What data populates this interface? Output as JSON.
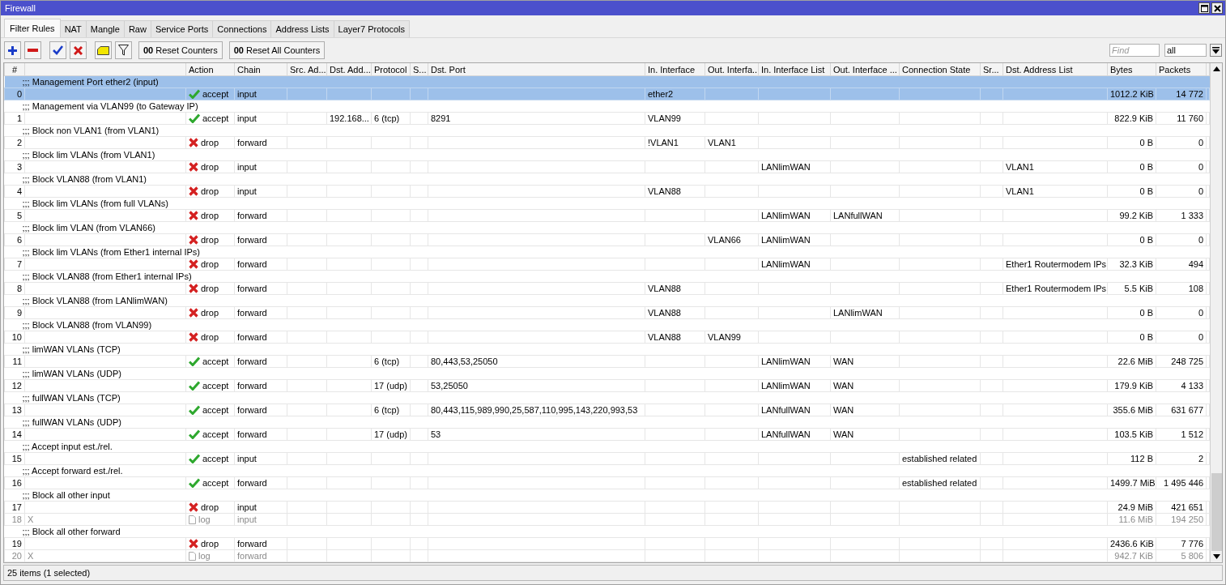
{
  "window": {
    "title": "Firewall"
  },
  "tabs": [
    {
      "label": "Filter Rules",
      "selected": true
    },
    {
      "label": "NAT",
      "selected": false
    },
    {
      "label": "Mangle",
      "selected": false
    },
    {
      "label": "Raw",
      "selected": false
    },
    {
      "label": "Service Ports",
      "selected": false
    },
    {
      "label": "Connections",
      "selected": false
    },
    {
      "label": "Address Lists",
      "selected": false
    },
    {
      "label": "Layer7 Protocols",
      "selected": false
    }
  ],
  "toolbar": {
    "buttons": [
      {
        "kind": "add"
      },
      {
        "kind": "remove"
      },
      {
        "kind": "enable"
      },
      {
        "kind": "disable"
      },
      {
        "kind": "comment"
      },
      {
        "kind": "filter"
      },
      {
        "kind": "text",
        "label": "**00** Reset Counters"
      },
      {
        "kind": "text",
        "label": "**00** Reset All Counters"
      }
    ],
    "find": {
      "placeholder": "Find"
    },
    "filter_select": {
      "value": "all"
    }
  },
  "table": {
    "columns": [
      "#",
      "Action",
      "Chain",
      "Src. Ad...",
      "Dst. Add...",
      "Protocol",
      "S...",
      "Dst. Port",
      "In. Interface",
      "Out. Interfa...",
      "In. Interface List",
      "Out. Interface ...",
      "Connection State",
      "Sr...",
      "Dst. Address List",
      "Bytes",
      "Packets"
    ],
    "rules": [
      {
        "comment": ";;; Management Port ether2 (input)",
        "selected": true,
        "disabled": false,
        "num": "0",
        "kind": "accept",
        "action": "accept",
        "chain": "input",
        "in_interface": "ether2",
        "bytes": "1012.2 KiB",
        "packets": "14 772"
      },
      {
        "comment": ";;; Management via VLAN99 (to Gateway IP)",
        "selected": false,
        "disabled": false,
        "num": "1",
        "kind": "accept",
        "action": "accept",
        "chain": "input",
        "dst_address": "192.168...",
        "protocol": "6 (tcp)",
        "dst_port": "8291",
        "in_interface": "VLAN99",
        "bytes": "822.9 KiB",
        "packets": "11 760"
      },
      {
        "comment": ";;; Block non VLAN1 (from VLAN1)",
        "selected": false,
        "disabled": false,
        "num": "2",
        "kind": "drop",
        "action": "drop",
        "chain": "forward",
        "in_interface": "!VLAN1",
        "out_interface": "VLAN1",
        "bytes": "0 B",
        "packets": "0"
      },
      {
        "comment": ";;; Block lim VLANs (from VLAN1)",
        "selected": false,
        "disabled": false,
        "num": "3",
        "kind": "drop",
        "action": "drop",
        "chain": "input",
        "in_interface_list": "LANlimWAN",
        "dst_address_list": "VLAN1",
        "bytes": "0 B",
        "packets": "0"
      },
      {
        "comment": ";;; Block VLAN88 (from VLAN1)",
        "selected": false,
        "disabled": false,
        "num": "4",
        "kind": "drop",
        "action": "drop",
        "chain": "input",
        "in_interface": "VLAN88",
        "dst_address_list": "VLAN1",
        "bytes": "0 B",
        "packets": "0"
      },
      {
        "comment": ";;; Block lim VLANs (from full VLANs)",
        "selected": false,
        "disabled": false,
        "num": "5",
        "kind": "drop",
        "action": "drop",
        "chain": "forward",
        "in_interface_list": "LANlimWAN",
        "out_interface_list": "LANfullWAN",
        "bytes": "99.2 KiB",
        "packets": "1 333"
      },
      {
        "comment": ";;; Block lim VLAN (from VLAN66)",
        "selected": false,
        "disabled": false,
        "num": "6",
        "kind": "drop",
        "action": "drop",
        "chain": "forward",
        "out_interface": "VLAN66",
        "in_interface_list": "LANlimWAN",
        "bytes": "0 B",
        "packets": "0"
      },
      {
        "comment": ";;; Block lim VLANs (from Ether1 internal IPs)",
        "selected": false,
        "disabled": false,
        "num": "7",
        "kind": "drop",
        "action": "drop",
        "chain": "forward",
        "in_interface_list": "LANlimWAN",
        "dst_address_list": "Ether1 Routermodem IPs",
        "bytes": "32.3 KiB",
        "packets": "494"
      },
      {
        "comment": ";;; Block VLAN88 (from Ether1 internal IPs)",
        "selected": false,
        "disabled": false,
        "num": "8",
        "kind": "drop",
        "action": "drop",
        "chain": "forward",
        "in_interface": "VLAN88",
        "dst_address_list": "Ether1 Routermodem IPs",
        "bytes": "5.5 KiB",
        "packets": "108"
      },
      {
        "comment": ";;; Block VLAN88 (from LANlimWAN)",
        "selected": false,
        "disabled": false,
        "num": "9",
        "kind": "drop",
        "action": "drop",
        "chain": "forward",
        "in_interface": "VLAN88",
        "out_interface_list": "LANlimWAN",
        "bytes": "0 B",
        "packets": "0"
      },
      {
        "comment": ";;; Block VLAN88 (from VLAN99)",
        "selected": false,
        "disabled": false,
        "num": "10",
        "kind": "drop",
        "action": "drop",
        "chain": "forward",
        "in_interface": "VLAN88",
        "out_interface": "VLAN99",
        "bytes": "0 B",
        "packets": "0"
      },
      {
        "comment": ";;; limWAN VLANs (TCP)",
        "selected": false,
        "disabled": false,
        "num": "11",
        "kind": "accept",
        "action": "accept",
        "chain": "forward",
        "protocol": "6 (tcp)",
        "dst_port": "80,443,53,25050",
        "in_interface_list": "LANlimWAN",
        "out_interface_list": "WAN",
        "bytes": "22.6 MiB",
        "packets": "248 725"
      },
      {
        "comment": ";;; limWAN VLANs (UDP)",
        "selected": false,
        "disabled": false,
        "num": "12",
        "kind": "accept",
        "action": "accept",
        "chain": "forward",
        "protocol": "17 (udp)",
        "dst_port": "53,25050",
        "in_interface_list": "LANlimWAN",
        "out_interface_list": "WAN",
        "bytes": "179.9 KiB",
        "packets": "4 133"
      },
      {
        "comment": ";;; fullWAN VLANs (TCP)",
        "selected": false,
        "disabled": false,
        "num": "13",
        "kind": "accept",
        "action": "accept",
        "chain": "forward",
        "protocol": "6 (tcp)",
        "dst_port": "80,443,115,989,990,25,587,110,995,143,220,993,53",
        "in_interface_list": "LANfullWAN",
        "out_interface_list": "WAN",
        "bytes": "355.6 MiB",
        "packets": "631 677"
      },
      {
        "comment": ";;; fullWAN VLANs (UDP)",
        "selected": false,
        "disabled": false,
        "num": "14",
        "kind": "accept",
        "action": "accept",
        "chain": "forward",
        "protocol": "17 (udp)",
        "dst_port": "53",
        "in_interface_list": "LANfullWAN",
        "out_interface_list": "WAN",
        "bytes": "103.5 KiB",
        "packets": "1 512"
      },
      {
        "comment": ";;; Accept input est./rel.",
        "selected": false,
        "disabled": false,
        "num": "15",
        "kind": "accept",
        "action": "accept",
        "chain": "input",
        "connection_state": "established related",
        "bytes": "112 B",
        "packets": "2"
      },
      {
        "comment": ";;; Accept forward est./rel.",
        "selected": false,
        "disabled": false,
        "num": "16",
        "kind": "accept",
        "action": "accept",
        "chain": "forward",
        "connection_state": "established related",
        "bytes": "1499.7 MiB",
        "packets": "1 495 446"
      },
      {
        "comment": ";;; Block all other input",
        "selected": false,
        "disabled": false,
        "num": "17",
        "kind": "drop",
        "action": "drop",
        "chain": "input",
        "bytes": "24.9 MiB",
        "packets": "421 651"
      },
      {
        "selected": false,
        "disabled": true,
        "num": "18",
        "column_2": "X",
        "kind": "log",
        "action": "log",
        "chain": "input",
        "bytes": "11.6 MiB",
        "packets": "194 250"
      },
      {
        "comment": ";;; Block all other forward",
        "selected": false,
        "disabled": false,
        "num": "19",
        "kind": "drop",
        "action": "drop",
        "chain": "forward",
        "bytes": "2436.6 KiB",
        "packets": "7 776"
      },
      {
        "selected": false,
        "disabled": true,
        "num": "20",
        "column_2": "X",
        "kind": "log",
        "action": "log",
        "chain": "forward",
        "bytes": "942.7 KiB",
        "packets": "5 806"
      }
    ]
  },
  "status_bar": "25 items (1 selected)"
}
